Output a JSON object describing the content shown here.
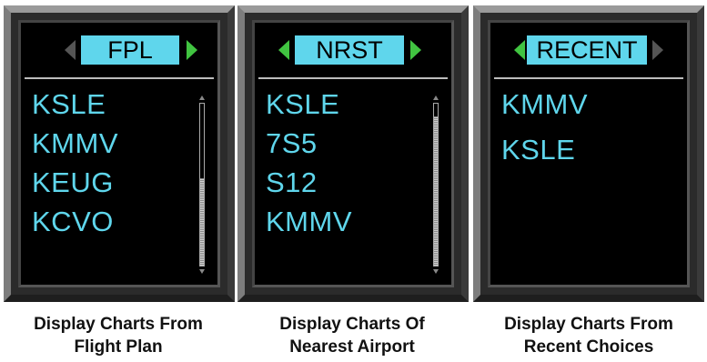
{
  "colors": {
    "tab_bg": "#5fd6ec",
    "list_text": "#5fd6ec",
    "arrow_active": "#41c441",
    "arrow_inactive": "#555555"
  },
  "panels": [
    {
      "tab": "FPL",
      "left_arrow_active": false,
      "right_arrow_active": true,
      "items": [
        "KSLE",
        "KMMV",
        "KEUG",
        "KCVO"
      ],
      "caption_line1": "Display Charts From",
      "caption_line2": "Flight Plan"
    },
    {
      "tab": "NRST",
      "left_arrow_active": true,
      "right_arrow_active": true,
      "items": [
        "KSLE",
        "7S5",
        "S12",
        "KMMV"
      ],
      "caption_line1": "Display Charts Of",
      "caption_line2": "Nearest Airport"
    },
    {
      "tab": "RECENT",
      "left_arrow_active": true,
      "right_arrow_active": false,
      "items": [
        "KMMV",
        "KSLE"
      ],
      "caption_line1": "Display Charts From",
      "caption_line2": "Recent Choices"
    }
  ]
}
